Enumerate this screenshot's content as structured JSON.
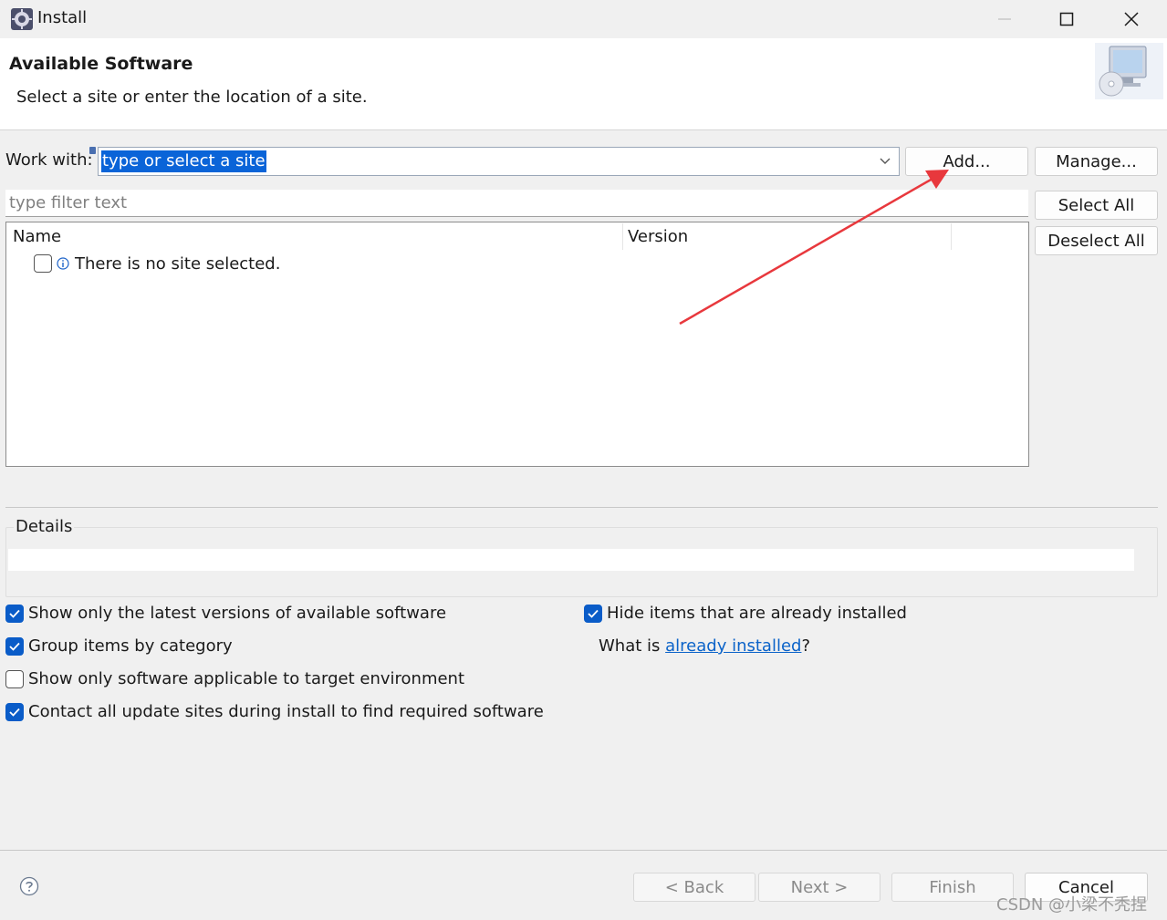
{
  "window": {
    "title": "Install",
    "icon": "eclipse-gear-icon",
    "controls": [
      "minimize-icon",
      "maximize-icon",
      "close-icon"
    ]
  },
  "header": {
    "title": "Available Software",
    "description": "Select a site or enter the location of a site.",
    "icon": "computer-cd-icon"
  },
  "work_with": {
    "label": "Work with:",
    "value": "type or select a site"
  },
  "buttons": {
    "add": "Add...",
    "manage": "Manage...",
    "select_all": "Select All",
    "deselect_all": "Deselect All"
  },
  "filter": {
    "placeholder": "type filter text"
  },
  "tree": {
    "columns": [
      "Name",
      "Version"
    ],
    "rows": [
      {
        "text": "There is no site selected.",
        "checked": false,
        "icon": "info-icon"
      }
    ]
  },
  "details": {
    "label": "Details",
    "text": ""
  },
  "options": {
    "show_latest": {
      "label": "Show only the latest versions of available software",
      "checked": true
    },
    "group_by_category": {
      "label": "Group items by category",
      "checked": true
    },
    "show_applicable": {
      "label": "Show only software applicable to target environment",
      "checked": false
    },
    "contact_all": {
      "label": "Contact all update sites during install to find required software",
      "checked": true
    },
    "hide_installed": {
      "label": "Hide items that are already installed",
      "checked": true
    }
  },
  "what_installed": {
    "prefix": "What is ",
    "link": "already installed",
    "suffix": "?"
  },
  "footer": {
    "back": "< Back",
    "next": "Next >",
    "finish": "Finish",
    "cancel": "Cancel"
  },
  "watermark": "CSDN @小梁不秃捏",
  "colors": {
    "accent": "#0a5cc8",
    "selection": "#0a64d8",
    "annotation_arrow": "#e8383d",
    "link": "#0b63c9"
  }
}
